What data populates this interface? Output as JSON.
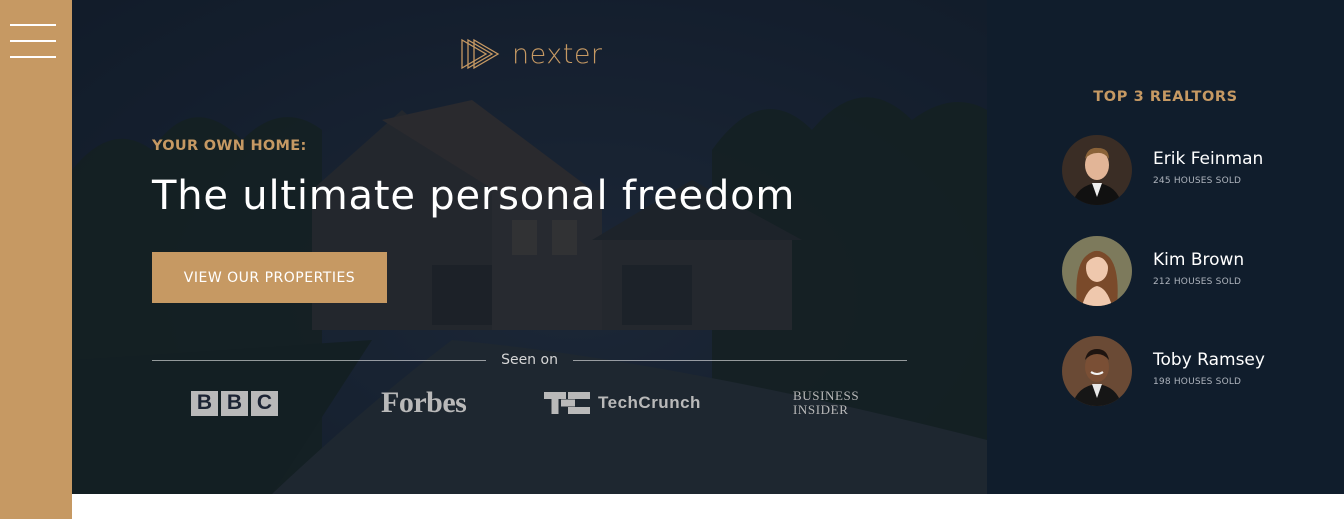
{
  "navigation": {
    "menu_icon": "hamburger-menu-icon"
  },
  "header": {
    "logo_text": "nexter",
    "logo_icon": "triangle-play-logo-icon",
    "subtitle": "YOUR OWN HOME:",
    "title": "The ultimate personal freedom",
    "cta_label": "VIEW OUR PROPERTIES",
    "seen_on": "Seen on",
    "press_logos": {
      "bbc": [
        "B",
        "B",
        "C"
      ],
      "forbes": "Forbes",
      "techcrunch_mark": "techcrunch-mark-icon",
      "techcrunch": "TechCrunch",
      "business_insider_line1": "BUSINESS",
      "business_insider_line2": "INSIDER"
    }
  },
  "realtors": {
    "title": "TOP 3 REALTORS",
    "items": [
      {
        "name": "Erik Feinman",
        "sold": "245 HOUSES SOLD"
      },
      {
        "name": "Kim Brown",
        "sold": "212 HOUSES SOLD"
      },
      {
        "name": "Toby Ramsey",
        "sold": "198 HOUSES SOLD"
      }
    ]
  },
  "colors": {
    "accent": "#c69963",
    "dark": "#101d2c",
    "white": "#ffffff"
  }
}
